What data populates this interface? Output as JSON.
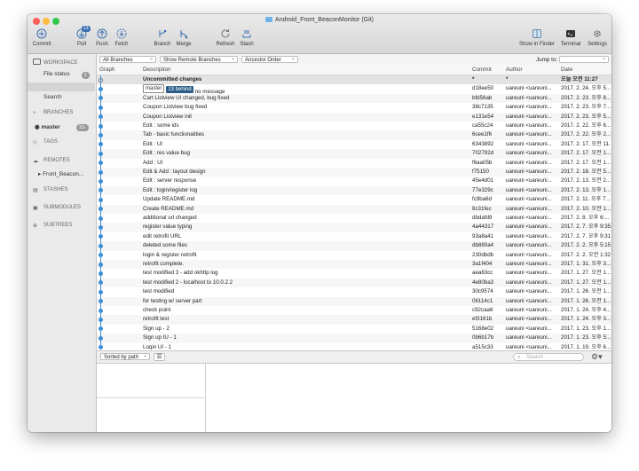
{
  "window": {
    "title": "Android_Front_BeaconMonitor (Git)",
    "traffic_colors": [
      "#fc605c",
      "#fdbc40",
      "#34c84a"
    ]
  },
  "toolbar": {
    "commit": "Commit",
    "pull": "Pull",
    "pull_badge": "13",
    "push": "Push",
    "fetch": "Fetch",
    "branch": "Branch",
    "merge": "Merge",
    "refresh": "Refresh",
    "stash": "Stash",
    "show_in_finder": "Show in Finder",
    "terminal": "Terminal",
    "settings": "Settings"
  },
  "sidebar": {
    "workspace": "WORKSPACE",
    "file_status": "File status",
    "file_status_badge": "1",
    "search": "Search",
    "branches": "BRANCHES",
    "master": "master",
    "master_badge": "13↓",
    "tags": "TAGS",
    "remotes": "REMOTES",
    "remote_item": "Front_Beacon...",
    "stashes": "STASHES",
    "submodules": "SUBMODULES",
    "subtrees": "SUBTREES"
  },
  "filters": {
    "branches": "All Branches",
    "remote": "Show Remote Branches",
    "order": "Ancestor Order",
    "jump_to": "Jump to:"
  },
  "columns": {
    "graph": "Graph",
    "description": "Description",
    "commit": "Commit",
    "author": "Author",
    "date": "Date"
  },
  "master_tag": "master",
  "behind_tag": "13 behind",
  "rows": [
    {
      "desc": "Uncommitted changes",
      "commit": "*",
      "author": "*",
      "date": "오늘 오전 11:27"
    },
    {
      "desc": "no message",
      "commit": "d18ee50",
      "author": "uareuni <uareuni...",
      "date": "2017. 2. 24. 오후 5..."
    },
    {
      "desc": "Cart Listview UI changed, bug fixed",
      "commit": "bfd56ab",
      "author": "uareuni <uareuni...",
      "date": "2017. 2. 23. 오후 8..."
    },
    {
      "desc": "Coupon Listview bug fixed",
      "commit": "38c7135",
      "author": "uareuni <uareuni...",
      "date": "2017. 2. 23. 오후 7..."
    },
    {
      "desc": "Coupon Listview init",
      "commit": "e131e54",
      "author": "uareuni <uareuni...",
      "date": "2017. 2. 23. 오후 5..."
    },
    {
      "desc": "Edit : some ids",
      "commit": "ca55c24",
      "author": "uareuni <uareuni...",
      "date": "2017. 2. 22. 오후 6..."
    },
    {
      "desc": "Tab - basic functionalities",
      "commit": "6cee1f6",
      "author": "uareuni <uareuni...",
      "date": "2017. 2. 22. 오후 2..."
    },
    {
      "desc": "Edit : UI",
      "commit": "6343892",
      "author": "uareuni <uareuni...",
      "date": "2017. 2. 17. 오전 11..."
    },
    {
      "desc": "Edit : res value bug",
      "commit": "702792d",
      "author": "uareuni <uareuni...",
      "date": "2017. 2. 17. 오전 1..."
    },
    {
      "desc": "Add : UI",
      "commit": "f6aa05b",
      "author": "uareuni <uareuni...",
      "date": "2017. 2. 17. 오전 1..."
    },
    {
      "desc": "Edit & Add : layout design",
      "commit": "f75150",
      "author": "uareuni <uareuni...",
      "date": "2017. 2. 16. 오전 5..."
    },
    {
      "desc": "Edit : server response",
      "commit": "45e4d01",
      "author": "uareuni <uareuni...",
      "date": "2017. 2. 13. 오전 2..."
    },
    {
      "desc": "Edit : login/register log",
      "commit": "77e329c",
      "author": "uareuni <uareuni...",
      "date": "2017. 2. 13. 오후 1..."
    },
    {
      "desc": "Update README.md",
      "commit": "fc9ba6d",
      "author": "uareuni <uareuni...",
      "date": "2017. 2. 11. 오후 7..."
    },
    {
      "desc": "Create README.md",
      "commit": "8c31fec",
      "author": "uareuni <uareuni...",
      "date": "2017. 2. 10. 오전 1..."
    },
    {
      "desc": "additional url changed",
      "commit": "dbdafd9",
      "author": "uareuni <uareuni...",
      "date": "2017. 2. 8. 오후 6:..."
    },
    {
      "desc": "register value typing",
      "commit": "4a44317",
      "author": "uareuni <uareuni...",
      "date": "2017. 2. 7. 오후 9:35"
    },
    {
      "desc": "edit retrofit URL",
      "commit": "93a8a41",
      "author": "uareuni <uareuni...",
      "date": "2017. 2. 7. 오후 9:31"
    },
    {
      "desc": "deleted some files",
      "commit": "db880a4",
      "author": "uareuni <uareuni...",
      "date": "2017. 2. 2. 오후 5:15"
    },
    {
      "desc": "login & register retrofit",
      "commit": "230dbdb",
      "author": "uareuni <uareuni...",
      "date": "2017. 2. 2. 오전 1:32"
    },
    {
      "desc": "retrofit complete.",
      "commit": "3a1f404",
      "author": "uareuni <uareuni...",
      "date": "2017. 1. 31. 오후 3..."
    },
    {
      "desc": "test modified 3 - add okhttp log",
      "commit": "aea63cc",
      "author": "uareuni <uareuni...",
      "date": "2017. 1. 27. 오전 1..."
    },
    {
      "desc": "test modified 2 - localhost to 10.0.2.2",
      "commit": "4e80ba3",
      "author": "uareuni <uareuni...",
      "date": "2017. 1. 27. 오전 1..."
    },
    {
      "desc": "test modified",
      "commit": "30c9574",
      "author": "uareuni <uareuni...",
      "date": "2017. 1. 26. 오전 1..."
    },
    {
      "desc": "for testing w/ server part",
      "commit": "06114c1",
      "author": "uareuni <uareuni...",
      "date": "2017. 1. 26. 오전 1..."
    },
    {
      "desc": "check point",
      "commit": "c92caa6",
      "author": "uareuni <uareuni...",
      "date": "2017. 1. 24. 오후 4..."
    },
    {
      "desc": "retrofit test",
      "commit": "ef3161b",
      "author": "uareuni <uareuni...",
      "date": "2017. 1. 24. 오후 3..."
    },
    {
      "desc": "Sign up - 2",
      "commit": "5168e02",
      "author": "uareuni <uareuni...",
      "date": "2017. 1. 23. 오후 1..."
    },
    {
      "desc": "Sign up IU - 1",
      "commit": "0b6b17b",
      "author": "uareuni <uareuni...",
      "date": "2017. 1. 23. 오후 5:..."
    },
    {
      "desc": "Login UI - 1",
      "commit": "a515c33",
      "author": "uareuni <uareuni...",
      "date": "2017. 1. 19. 오후 6..."
    }
  ],
  "bottom": {
    "sorted_by": "Sorted by path",
    "search_placeholder": "Search"
  }
}
